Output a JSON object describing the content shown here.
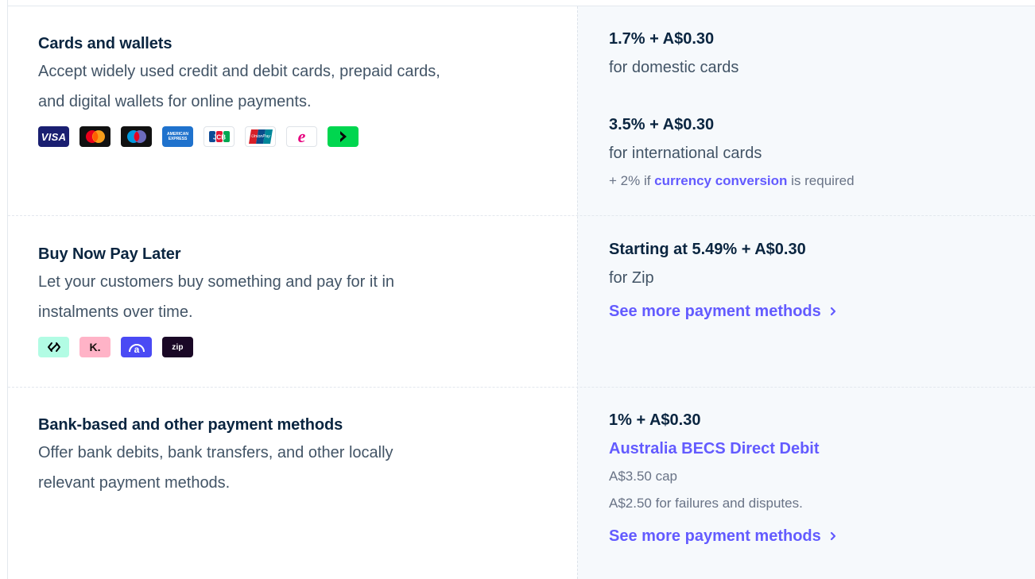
{
  "sections": [
    {
      "title": "Cards and wallets",
      "description": [
        "Accept widely used credit and debit cards, prepaid cards,",
        "and digital wallets for online payments."
      ],
      "icons": [
        "visa-icon",
        "mastercard-icon",
        "maestro-icon",
        "amex-icon",
        "jcb-icon",
        "unionpay-icon",
        "eftpos-icon",
        "arrow-pay-icon"
      ],
      "icon_text": {
        "visa": "VISA",
        "amex": "AMERICAN EXPRESS",
        "jcb": "JCB",
        "unionpay": "UnionPay",
        "eftpos": "e"
      },
      "prices": [
        {
          "price": "1.7% + A$0.30",
          "label": "for domestic cards"
        },
        {
          "price": "3.5% + A$0.30",
          "label": "for international cards"
        }
      ],
      "note": {
        "prefix": "+ 2% if ",
        "link": "currency conversion",
        "suffix": " is required"
      }
    },
    {
      "title": "Buy Now Pay Later",
      "description": [
        "Let your customers buy something and pay for it in",
        "instalments over time."
      ],
      "icons": [
        "afterpay-icon",
        "klarna-icon",
        "affirm-icon",
        "zip-icon"
      ],
      "icon_text": {
        "klarna": "K.",
        "affirm": "a",
        "zip": "zip"
      },
      "price": "Starting at 5.49% + A$0.30",
      "label": "for Zip",
      "more_link": "See more payment methods"
    },
    {
      "title": "Bank-based and other payment methods",
      "description": [
        "Offer bank debits, bank transfers, and other locally",
        "relevant payment methods."
      ],
      "price": "1% + A$0.30",
      "method_link": "Australia BECS Direct Debit",
      "details": [
        "A$3.50 cap",
        "A$2.50 for failures and disputes."
      ],
      "more_link": "See more payment methods"
    }
  ],
  "colors": {
    "accent": "#635bff",
    "heading": "#0a2540",
    "body": "#425466",
    "muted": "#697386"
  }
}
